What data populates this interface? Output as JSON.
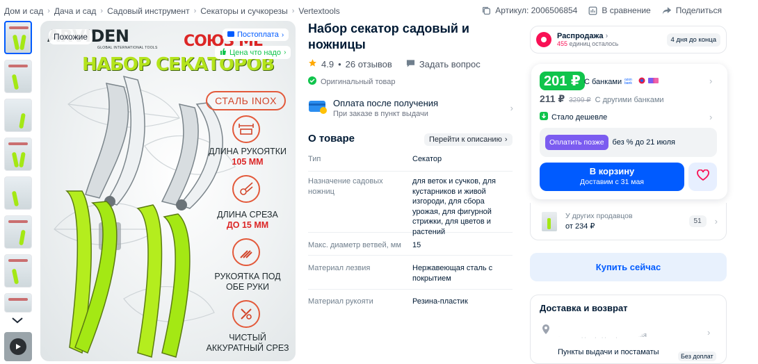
{
  "breadcrumbs": [
    "Дом и сад",
    "Дача и сад",
    "Садовый инструмент",
    "Секаторы и сучкорезы",
    "Vertextools"
  ],
  "topbar": {
    "article": "Артикул: 2006506854",
    "compare": "В сравнение",
    "share": "Поделиться"
  },
  "gallery": {
    "similar_badge": "Похожие",
    "brand": "ARVIDEN",
    "brand_sub": "GLOBAL INTERNATIONAL TOOLS",
    "headline": "НАБОР СЕКАТОРОВ",
    "top_red_text": "СОЮЗ МЕ",
    "chip_postpay": "Постоплата",
    "chip_good_price": "Цена что надо",
    "steel_label": "СТАЛЬ INOX",
    "features": [
      {
        "label": "ДЛИНА РУКОЯТКИ",
        "value": "105 ММ",
        "icon": "ruler-icon"
      },
      {
        "label": "ДЛИНА СРЕЗА",
        "value": "ДО 15 ММ",
        "icon": "cut-length-icon"
      },
      {
        "label": "РУКОЯТКА ПОД ОБЕ РУКИ",
        "value": "",
        "icon": "hands-icon"
      },
      {
        "label": "ЧИСТЫЙ АККУРАТНЫЙ СРЕЗ",
        "value": "",
        "icon": "clean-cut-icon"
      }
    ]
  },
  "product": {
    "title": "Набор секатор садовый и ножницы",
    "rating": "4.9",
    "reviews": "26 отзывов",
    "ask_question": "Задать вопрос",
    "original": "Оригинальный товар",
    "pay_after_title": "Оплата после получения",
    "pay_after_sub": "При заказе в пункт выдачи",
    "about_heading": "О товаре",
    "goto_description": "Перейти к описанию",
    "specs": [
      {
        "key": "Тип",
        "value": "Секатор"
      },
      {
        "key": "Назначение садовых ножниц",
        "value": "для веток и сучков, для кустарников и живой изгороди, для сбора урожая, для фигурной стрижки, для цветов и растений"
      },
      {
        "key": "Макс. диаметр ветвей, мм",
        "value": "15"
      },
      {
        "key": "Материал лезвия",
        "value": "Нержавеющая сталь с покрытием"
      },
      {
        "key": "Материал рукояти",
        "value": "Резина-пластик"
      }
    ]
  },
  "sale": {
    "title": "Распродажа",
    "remaining_count": "455",
    "remaining_text": "единиц осталось",
    "days_left": "4 дня до конца"
  },
  "price": {
    "with_card": "201 ₽",
    "with_card_label": "С банками",
    "other_price": "211 ₽",
    "old_price": "3299 ₽",
    "other_label": "С другими банками",
    "cheaper": "Стало дешевле",
    "pay_later_btn": "Оплатить позже",
    "pay_later_text": "без % до 21 июля",
    "cart_btn": "В корзину",
    "cart_sub": "Доставим с 31 мая"
  },
  "others": {
    "label": "У других продавцов",
    "price": "от 234 ₽",
    "count": "51"
  },
  "buy_now": "Купить сейчас",
  "delivery": {
    "heading": "Доставка и возврат",
    "location": "Со склада продавца: ...вская",
    "pickup": "Пункты выдачи и постаматы",
    "pickup_badge": "Без доплат"
  },
  "colors": {
    "accent": "#005bff",
    "green": "#10c44c",
    "sale_pink": "#f91155",
    "lime": "#a4e814"
  }
}
